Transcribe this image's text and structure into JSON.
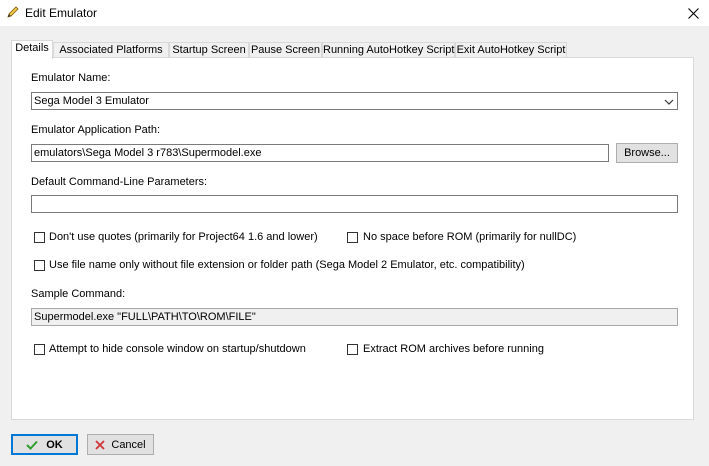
{
  "window": {
    "title": "Edit Emulator"
  },
  "tabs": [
    {
      "label": "Details"
    },
    {
      "label": "Associated Platforms"
    },
    {
      "label": "Startup Screen"
    },
    {
      "label": "Pause Screen"
    },
    {
      "label": "Running AutoHotkey Script"
    },
    {
      "label": "Exit AutoHotkey Script"
    }
  ],
  "details": {
    "emulator_name_label": "Emulator Name:",
    "emulator_name_value": "Sega Model 3 Emulator",
    "app_path_label": "Emulator Application Path:",
    "app_path_value": "emulators\\Sega Model 3 r783\\Supermodel.exe",
    "browse_label": "Browse...",
    "params_label": "Default Command-Line Parameters:",
    "params_value": "",
    "checks": {
      "no_quotes": {
        "label": "Don't use quotes (primarily for Project64 1.6 and lower)",
        "checked": false
      },
      "no_space": {
        "label": "No space before ROM (primarily for nullDC)",
        "checked": false
      },
      "filename_only": {
        "label": "Use file name only without file extension or folder path (Sega Model 2 Emulator, etc. compatibility)",
        "checked": false
      },
      "hide_console": {
        "label": "Attempt to hide console window on startup/shutdown",
        "checked": false
      },
      "extract_roms": {
        "label": "Extract ROM archives before running",
        "checked": false
      }
    },
    "sample_label": "Sample Command:",
    "sample_value": "Supermodel.exe \"FULL\\PATH\\TO\\ROM\\FILE\""
  },
  "footer": {
    "ok_label": "OK",
    "cancel_label": "Cancel"
  },
  "colors": {
    "accent": "#0078d7",
    "ok_check": "#2e9e2e",
    "cancel_x": "#d13438"
  }
}
